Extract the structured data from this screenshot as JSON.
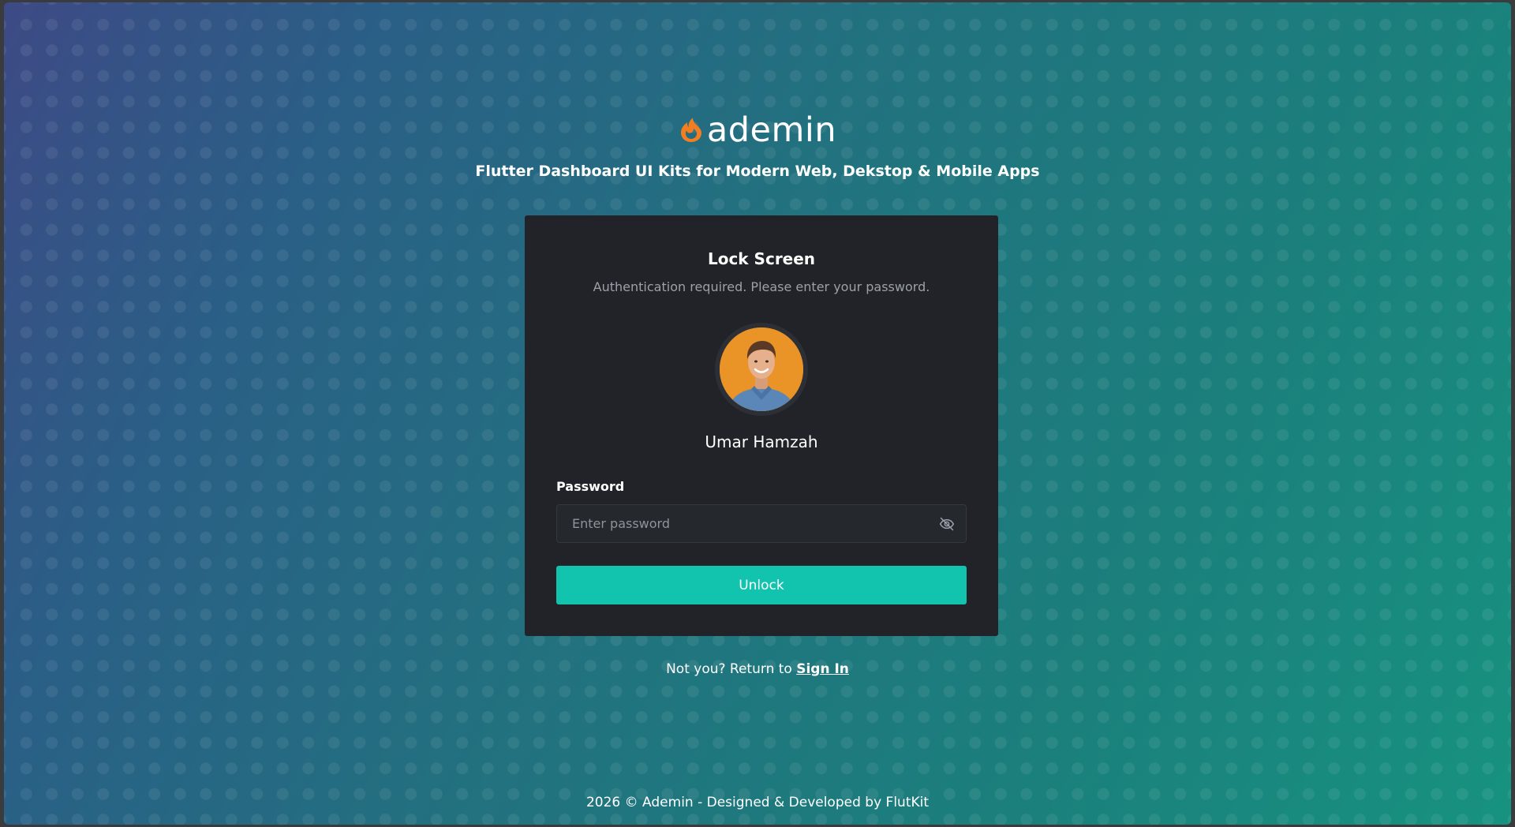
{
  "brand": {
    "name": "ademin",
    "tagline": "Flutter Dashboard UI Kits for Modern Web, Dekstop & Mobile Apps",
    "logo_icon": "flame-logo-icon",
    "accent_color": "#f47d20"
  },
  "card": {
    "title": "Lock Screen",
    "subtitle": "Authentication required. Please enter your password.",
    "user_name": "Umar Hamzah",
    "avatar_icon": "user-avatar",
    "password_label": "Password",
    "password_placeholder": "Enter password",
    "password_value": "",
    "toggle_icon": "eye-off-icon",
    "unlock_label": "Unlock",
    "button_color": "#12c3ae"
  },
  "return_link": {
    "prefix": "Not you? Return to ",
    "link_label": "Sign In"
  },
  "footer": {
    "text": "2026 © Ademin - Designed & Developed by FlutKit"
  }
}
